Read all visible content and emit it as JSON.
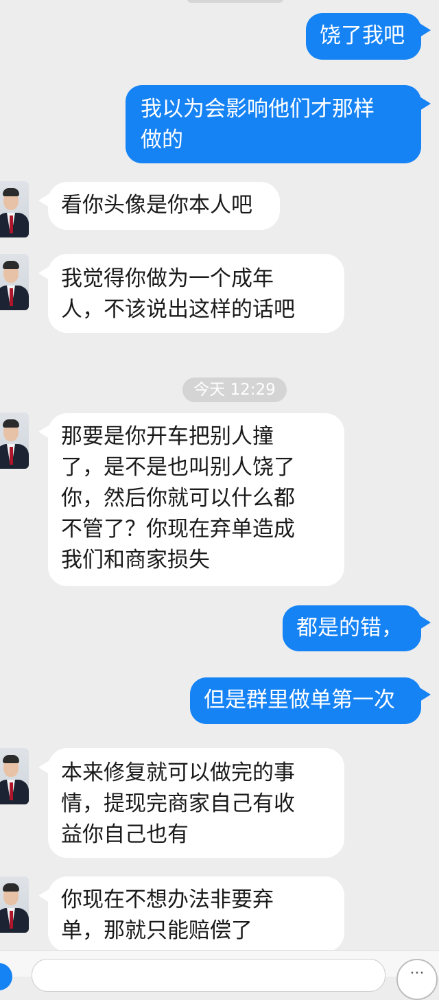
{
  "chat": {
    "timestamp": "今天 12:29",
    "messages": [
      {
        "side": "out",
        "text": "饶了我吧"
      },
      {
        "side": "out",
        "text": "我以为会影响他们才那样\n做的"
      },
      {
        "side": "in",
        "text": "看你头像是你本人吧"
      },
      {
        "side": "in",
        "text": "我觉得你做为一个成年\n人，不该说出这样的话吧"
      },
      {
        "side": "in",
        "text": "那要是你开车把别人撞\n了，是不是也叫别人饶了\n你，然后你就可以什么都\n不管了？你现在弃单造成\n我们和商家损失"
      },
      {
        "side": "out",
        "text": "都是的错，"
      },
      {
        "side": "out",
        "text": "但是群里做单第一次"
      },
      {
        "side": "in",
        "text": "本来修复就可以做完的事\n情，提现完商家自己有收\n益你自己也有"
      },
      {
        "side": "in",
        "text": "你现在不想办法非要弃\n单，那就只能赔偿了"
      }
    ]
  },
  "icons": {
    "input_left": "voice-icon",
    "input_right": "more-icon"
  },
  "colors": {
    "background": "#ededed",
    "outgoing_bubble": "#1683f5",
    "incoming_bubble": "#ffffff"
  }
}
